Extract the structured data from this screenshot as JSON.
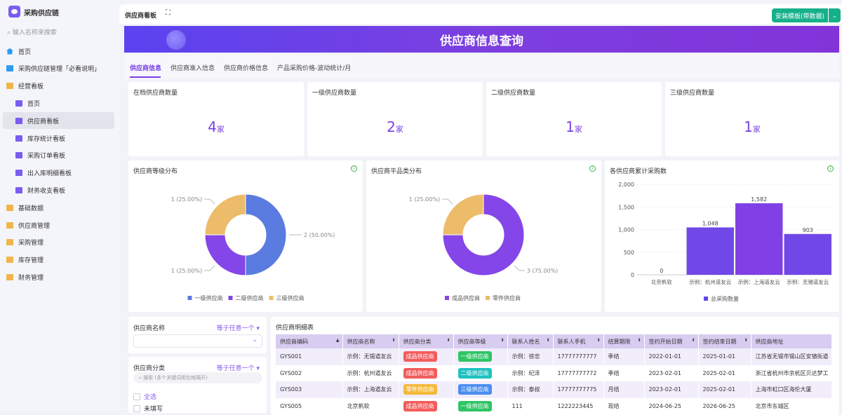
{
  "app": {
    "name": "采购供应链",
    "search_placeholder": "输入名称来搜索"
  },
  "sidebar": {
    "items": [
      {
        "label": "首页",
        "icon": "home-icon",
        "level": 0
      },
      {
        "label": "采购供应链管理「必看说明」",
        "icon": "doc-icon",
        "level": 0
      },
      {
        "label": "经营看板",
        "icon": "folder-icon",
        "level": 0
      },
      {
        "label": "首页",
        "icon": "chart-icon",
        "level": 1
      },
      {
        "label": "供应商看板",
        "icon": "chart-icon",
        "level": 1,
        "active": true
      },
      {
        "label": "库存统计看板",
        "icon": "chart-icon",
        "level": 1
      },
      {
        "label": "采购订单看板",
        "icon": "chart-icon",
        "level": 1
      },
      {
        "label": "出入库明细看板",
        "icon": "chart-icon",
        "level": 1
      },
      {
        "label": "财务收支看板",
        "icon": "chart-icon",
        "level": 1
      },
      {
        "label": "基础数据",
        "icon": "folder-icon",
        "level": 0
      },
      {
        "label": "供应商管理",
        "icon": "folder-icon",
        "level": 0
      },
      {
        "label": "采购管理",
        "icon": "folder-icon",
        "level": 0
      },
      {
        "label": "库存管理",
        "icon": "folder-icon",
        "level": 0
      },
      {
        "label": "财务管理",
        "icon": "folder-icon",
        "level": 0
      }
    ]
  },
  "header": {
    "title": "供应商看板",
    "install_label": "安装模板(带数据)",
    "banner_title": "供应商信息查询"
  },
  "tabs": [
    "供应商信息",
    "供应商准入信息",
    "供应商价格信息",
    "产品采购价格-波动统计/月"
  ],
  "kpis": [
    {
      "label": "在档供应商数量",
      "value": "4",
      "unit": "家"
    },
    {
      "label": "一级供应商数量",
      "value": "2",
      "unit": "家"
    },
    {
      "label": "二级供应商数量",
      "value": "1",
      "unit": "家"
    },
    {
      "label": "三级供应商数量",
      "value": "1",
      "unit": "家"
    }
  ],
  "chart_data": [
    {
      "type": "pie",
      "title": "供应商等级分布",
      "categories": [
        "一级供应商",
        "二级供应商",
        "三级供应商"
      ],
      "values": [
        2,
        1,
        1
      ],
      "labels": [
        "2 (50.00%)",
        "1 (25.00%)",
        "1 (25.00%)"
      ],
      "colors": [
        "#5a7be0",
        "#8446e8",
        "#ecbc6a"
      ]
    },
    {
      "type": "pie",
      "title": "供应商平品类分布",
      "categories": [
        "成品供应商",
        "零件供应商"
      ],
      "values": [
        3,
        1
      ],
      "labels": [
        "3 (75.00%)",
        "1 (25.00%)"
      ],
      "colors": [
        "#8446e8",
        "#ecbc6a"
      ]
    },
    {
      "type": "bar",
      "title": "各供应商累计采购数",
      "categories": [
        "北京帆软",
        "示例：杭州道友云",
        "示例：上海道友云",
        "示例：无锡道友云"
      ],
      "values": [
        0,
        1048,
        1582,
        903
      ],
      "value_labels": [
        "0",
        "1,048",
        "1,582",
        "903"
      ],
      "ylim": [
        0,
        2000
      ],
      "yticks": [
        "0",
        "500",
        "1,000",
        "1,500",
        "2,000"
      ],
      "legend": "总采购数量",
      "legend_position": "bottom",
      "colors": [
        "#7048e8",
        "#7048e8",
        "#8040e6",
        "#7048e8"
      ]
    }
  ],
  "filters": [
    {
      "label": "供应商名称",
      "operator": "等于任意一个"
    },
    {
      "label": "供应商分类",
      "operator": "等于任意一个",
      "search_placeholder": "搜索 (多个关键词用空格隔开)",
      "options": [
        "全选",
        "未填写"
      ]
    }
  ],
  "table": {
    "title": "供应商明细表",
    "columns": [
      "供应商编码",
      "供应商名称",
      "供应商分类",
      "供应商等级",
      "联系人姓名",
      "联系人手机",
      "结算期限",
      "签约开始日期",
      "签约结束日期",
      "供应商地址"
    ],
    "rows": [
      [
        "GYS001",
        "示例：无锡道友云",
        "成品供应商",
        "一级供应商",
        "示例：徐忠",
        "17777777777",
        "季结",
        "2022-01-01",
        "2025-01-01",
        "江苏省无锡市锡山区安镇街道"
      ],
      [
        "GYS002",
        "示例：杭州道友云",
        "成品供应商",
        "二级供应商",
        "示例：纪泽",
        "17777777772",
        "季结",
        "2023-02-01",
        "2025-02-01",
        "浙江省杭州市余杭区贝达梦工"
      ],
      [
        "GYS003",
        "示例：上海道友云",
        "零件供应商",
        "三级供应商",
        "示例：泰叔",
        "17777777775",
        "月结",
        "2023-02-01",
        "2025-02-01",
        "上海市虹口区海伦大厦"
      ],
      [
        "GYS005",
        "北京帆软",
        "成品供应商",
        "一级供应商",
        "111",
        "1222223445",
        "现结",
        "2024-06-25",
        "2026-06-25",
        "北京市东城区"
      ]
    ],
    "tag_colors": {
      "成品供应商": "#f25c5c",
      "零件供应商": "#f5b93a",
      "一级供应商": "#2fc566",
      "二级供应商": "#1fc2c0",
      "三级供应商": "#4a8df0"
    }
  }
}
